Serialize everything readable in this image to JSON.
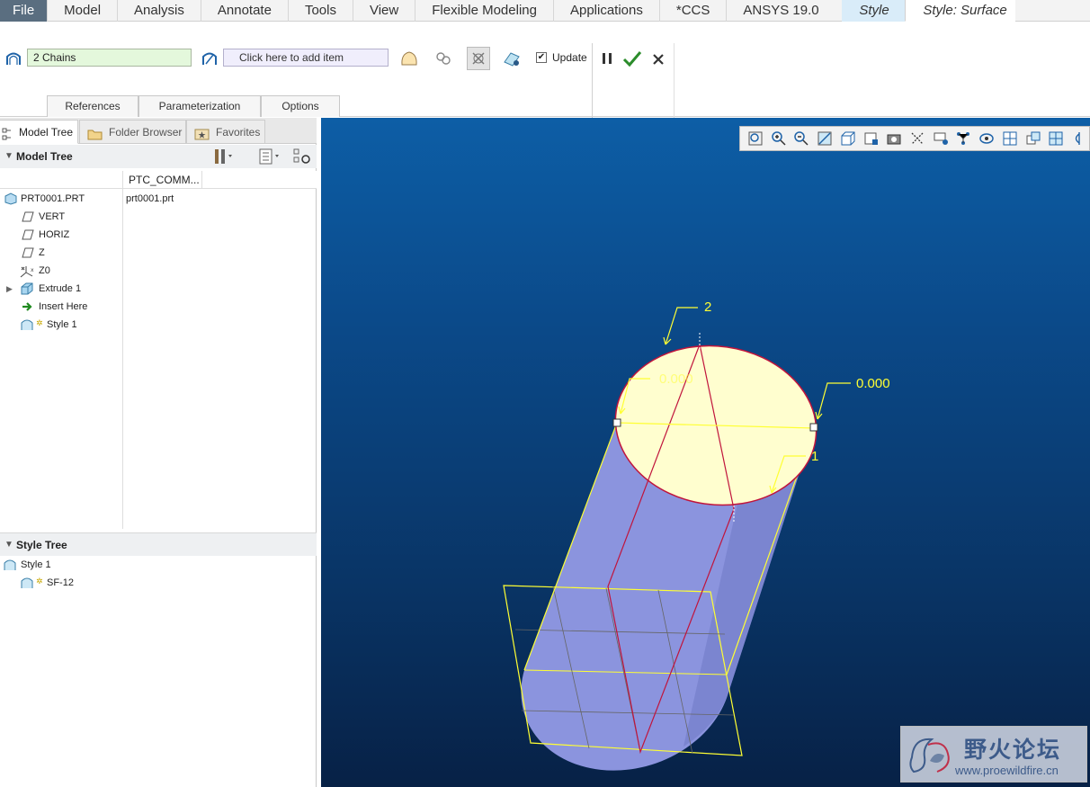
{
  "menubar": {
    "tabs": [
      "File",
      "Model",
      "Analysis",
      "Annotate",
      "Tools",
      "View",
      "Flexible Modeling",
      "Applications",
      "*CCS",
      "ANSYS 19.0"
    ],
    "context_tabs": [
      "Style",
      "Style: Surface"
    ]
  },
  "ribbon": {
    "chains_value": "2 Chains",
    "add_item_placeholder": "Click here to add item",
    "update_label": "Update",
    "update_checked": true,
    "subtabs": [
      "References",
      "Parameterization",
      "Options"
    ]
  },
  "navigator": {
    "tabs": [
      "Model Tree",
      "Folder Browser",
      "Favorites"
    ],
    "model_tree_title": "Model Tree",
    "column_header": "PTC_COMM...",
    "items": [
      {
        "label": "PRT0001.PRT",
        "value": "prt0001.prt",
        "icon": "part-icon"
      },
      {
        "label": "VERT",
        "icon": "datum-plane-icon"
      },
      {
        "label": "HORIZ",
        "icon": "datum-plane-icon"
      },
      {
        "label": "Z",
        "icon": "datum-plane-icon"
      },
      {
        "label": "Z0",
        "icon": "coordinate-system-icon"
      },
      {
        "label": "Extrude 1",
        "icon": "extrude-icon"
      },
      {
        "label": "Insert Here",
        "icon": "insert-arrow-icon"
      },
      {
        "label": "Style 1",
        "icon": "style-feature-icon"
      }
    ],
    "style_tree_title": "Style Tree",
    "style_items": [
      {
        "label": "Style 1",
        "icon": "style-feature-icon"
      },
      {
        "label": "SF-12",
        "icon": "style-surface-icon"
      }
    ]
  },
  "viewport": {
    "annotations": [
      "2",
      "0.000",
      "0.000",
      "1"
    ],
    "annotation_color": "#ffff33",
    "surface_fill": "#fffecf",
    "cylinder_color": "#8d96e0",
    "background_top": "#0d5ea6",
    "background_bottom": "#072146",
    "view_toolbar_icons": [
      "refit-icon",
      "zoom-in-icon",
      "zoom-out-icon",
      "repaint-icon",
      "display-style-icon",
      "saved-orientations-icon",
      "named-views-icon",
      "datum-display-icon",
      "spin-center-icon",
      "annotation-display-icon",
      "coordinate-display-icon",
      "view-manager-icon",
      "section-icon",
      "perspective-icon",
      "appearance-icon"
    ]
  },
  "watermark": {
    "title": "野火论坛",
    "url": "www.proewildfire.cn"
  }
}
